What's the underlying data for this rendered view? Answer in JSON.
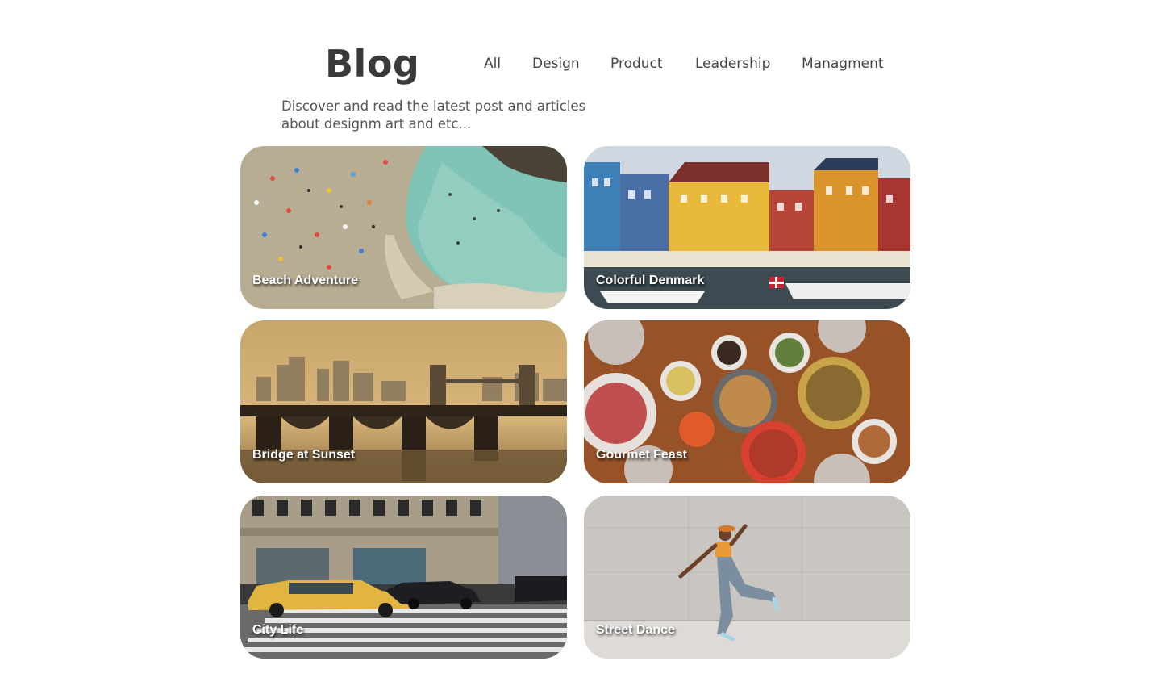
{
  "header": {
    "title": "Blog",
    "subtitle": "Discover and read the latest post and articles about designm art and etc..."
  },
  "nav": {
    "items": [
      {
        "label": "All"
      },
      {
        "label": "Design"
      },
      {
        "label": "Product"
      },
      {
        "label": "Leadership"
      },
      {
        "label": "Managment"
      }
    ]
  },
  "posts": [
    {
      "title": "Beach Adventure",
      "image": "aerial-beach-photo"
    },
    {
      "title": "Colorful Denmark",
      "image": "nyhavn-houses-photo"
    },
    {
      "title": "Bridge at Sunset",
      "image": "london-bridge-sunset-photo"
    },
    {
      "title": "Gourmet Feast",
      "image": "dinner-table-photo"
    },
    {
      "title": "City Life",
      "image": "city-taxi-crosswalk-photo"
    },
    {
      "title": "Street Dance",
      "image": "street-dancer-photo"
    }
  ]
}
